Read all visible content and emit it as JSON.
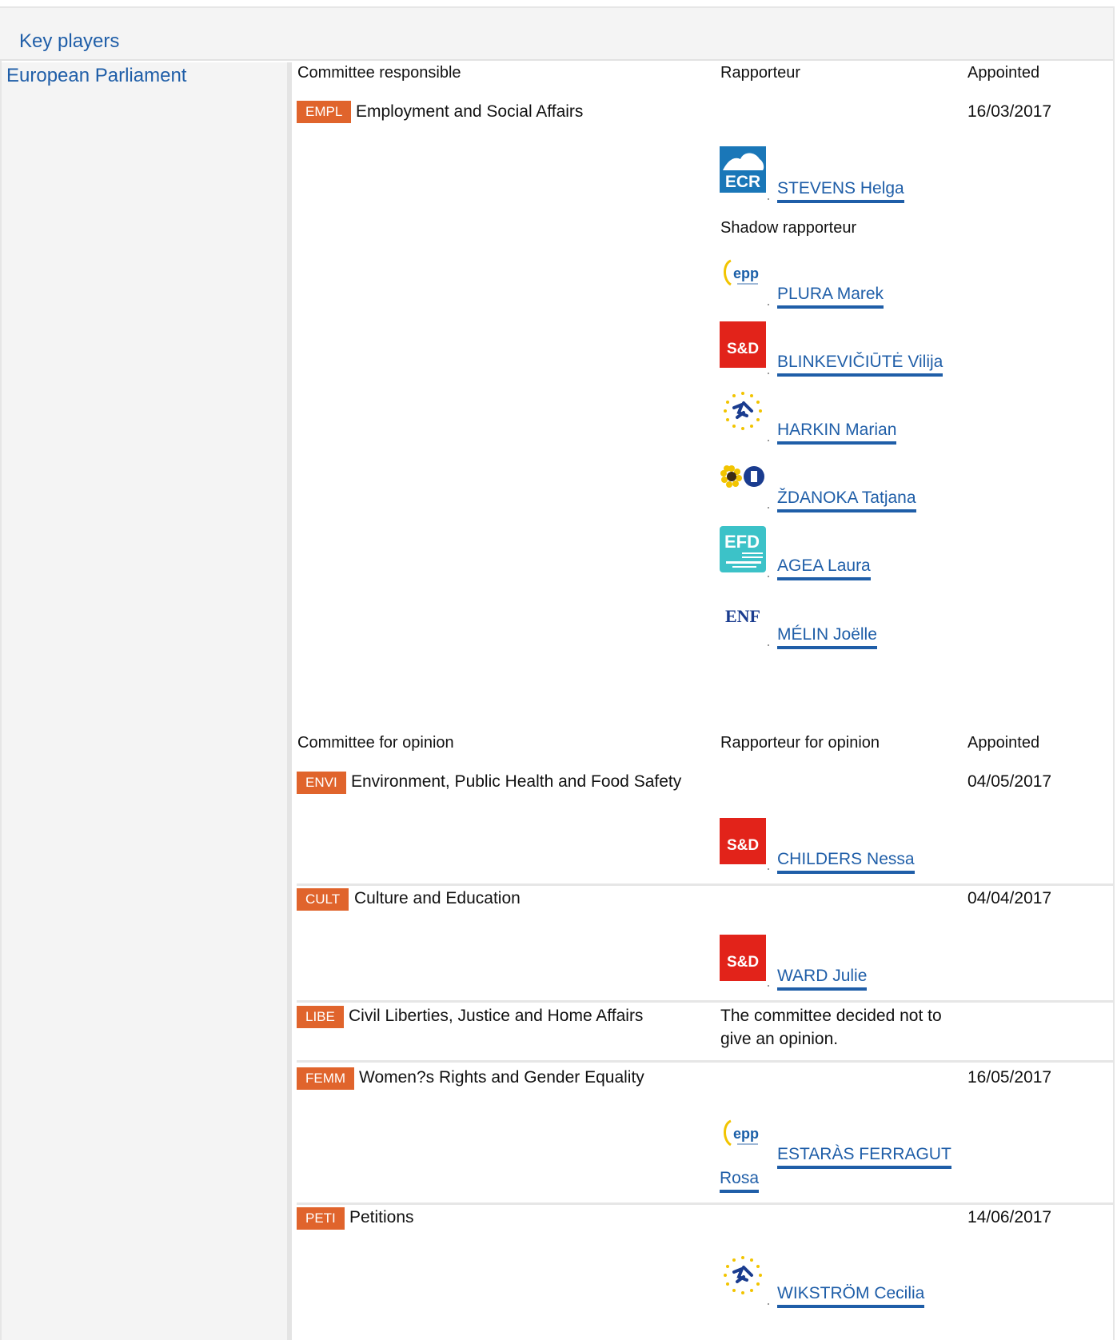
{
  "section": {
    "title": "Key players",
    "institution": "European Parliament"
  },
  "responsible": {
    "headers": {
      "committee": "Committee responsible",
      "rapporteur": "Rapporteur",
      "appointed": "Appointed"
    },
    "committee": {
      "code": "EMPL",
      "name": "Employment and Social Affairs",
      "date": "16/03/2017"
    },
    "rapporteur": {
      "name": "STEVENS Helga",
      "group_logo": "ECR"
    },
    "shadow_label": "Shadow rapporteur",
    "shadows": [
      {
        "name": "PLURA Marek",
        "group_logo": "epp"
      },
      {
        "name": "BLINKEVIČIŪTĖ Vilija",
        "group_logo": "S&D"
      },
      {
        "name": "HARKIN Marian",
        "group_logo": "alde-stars"
      },
      {
        "name": "ŽDANOKA Tatjana",
        "group_logo": "greens-efa"
      },
      {
        "name": "AGEA Laura",
        "group_logo": "EFD"
      },
      {
        "name": "MÉLIN Joëlle",
        "group_logo": "ENF"
      }
    ]
  },
  "opinion": {
    "headers": {
      "committee": "Committee for opinion",
      "rapporteur": "Rapporteur for opinion",
      "appointed": "Appointed"
    },
    "committees": [
      {
        "code": "ENVI",
        "name": "Environment, Public Health and Food Safety",
        "date": "04/05/2017",
        "rapporteur": "CHILDERS Nessa",
        "group_logo": "S&D"
      },
      {
        "code": "CULT",
        "name": "Culture and Education",
        "date": "04/04/2017",
        "rapporteur": "WARD Julie",
        "group_logo": "S&D"
      },
      {
        "code": "LIBE",
        "name": "Civil Liberties, Justice and Home Affairs",
        "note_line1": "The committee decided not to",
        "note_line2": "give an opinion."
      },
      {
        "code": "FEMM",
        "name": "Women?s Rights and Gender Equality",
        "date": "16/05/2017",
        "rapporteur_line1": "ESTARÀS FERRAGUT",
        "rapporteur_line2": "Rosa",
        "group_logo": "epp"
      },
      {
        "code": "PETI",
        "name": "Petitions",
        "date": "14/06/2017",
        "rapporteur": "WIKSTRÖM Cecilia",
        "group_logo": "alde-stars"
      }
    ]
  }
}
